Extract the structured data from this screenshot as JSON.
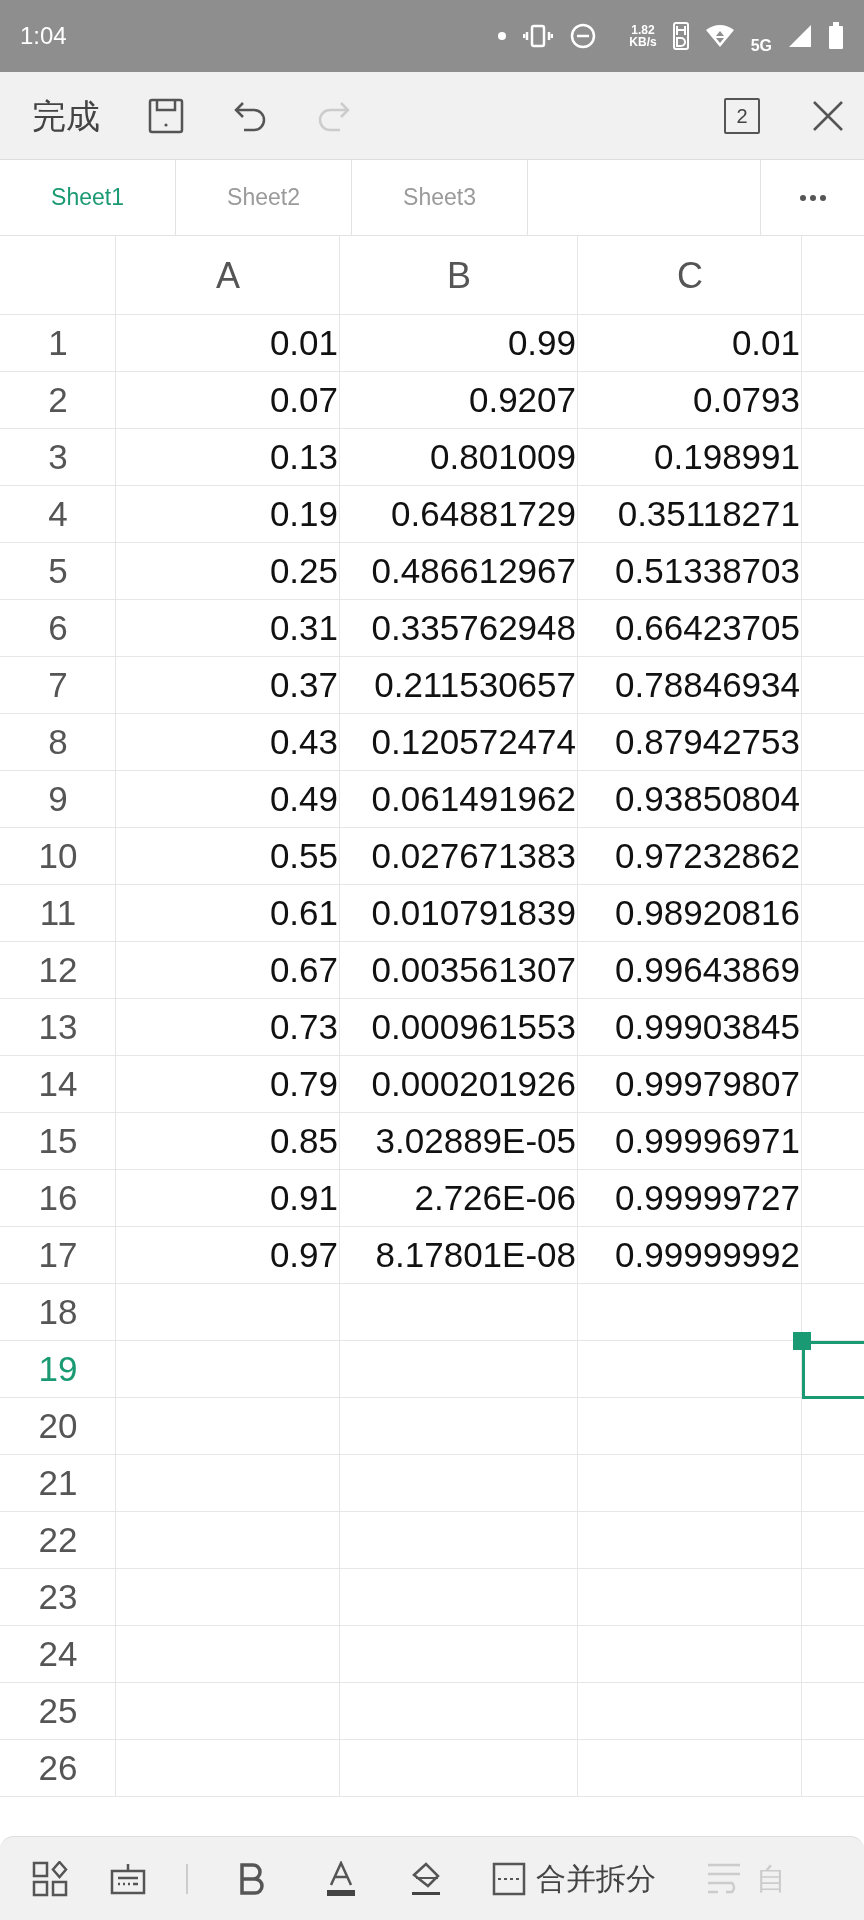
{
  "status_bar": {
    "time": "1:04",
    "speed_value": "1.82",
    "speed_unit": "KB/s",
    "network": "5G"
  },
  "toolbar": {
    "done": "完成",
    "undo_enabled": true,
    "redo_enabled": false,
    "window_count": "2"
  },
  "sheet_tabs": [
    {
      "label": "Sheet1",
      "selected": true
    },
    {
      "label": "Sheet2",
      "selected": false
    },
    {
      "label": "Sheet3",
      "selected": false
    }
  ],
  "table": {
    "columns": [
      "A",
      "B",
      "C"
    ],
    "rows": [
      {
        "number": "1",
        "selected": false,
        "cells": [
          "0.01",
          "0.99",
          "0.01"
        ]
      },
      {
        "number": "2",
        "selected": false,
        "cells": [
          "0.07",
          "0.9207",
          "0.0793"
        ]
      },
      {
        "number": "3",
        "selected": false,
        "cells": [
          "0.13",
          "0.801009",
          "0.198991"
        ]
      },
      {
        "number": "4",
        "selected": false,
        "cells": [
          "0.19",
          "0.64881729",
          "0.35118271"
        ]
      },
      {
        "number": "5",
        "selected": false,
        "cells": [
          "0.25",
          "0.486612967",
          "0.51338703"
        ]
      },
      {
        "number": "6",
        "selected": false,
        "cells": [
          "0.31",
          "0.335762948",
          "0.66423705"
        ]
      },
      {
        "number": "7",
        "selected": false,
        "cells": [
          "0.37",
          "0.211530657",
          "0.78846934"
        ]
      },
      {
        "number": "8",
        "selected": false,
        "cells": [
          "0.43",
          "0.120572474",
          "0.87942753"
        ]
      },
      {
        "number": "9",
        "selected": false,
        "cells": [
          "0.49",
          "0.061491962",
          "0.93850804"
        ]
      },
      {
        "number": "10",
        "selected": false,
        "cells": [
          "0.55",
          "0.027671383",
          "0.97232862"
        ]
      },
      {
        "number": "11",
        "selected": false,
        "cells": [
          "0.61",
          "0.010791839",
          "0.98920816"
        ]
      },
      {
        "number": "12",
        "selected": false,
        "cells": [
          "0.67",
          "0.003561307",
          "0.99643869"
        ]
      },
      {
        "number": "13",
        "selected": false,
        "cells": [
          "0.73",
          "0.000961553",
          "0.99903845"
        ]
      },
      {
        "number": "14",
        "selected": false,
        "cells": [
          "0.79",
          "0.000201926",
          "0.99979807"
        ]
      },
      {
        "number": "15",
        "selected": false,
        "cells": [
          "0.85",
          "3.02889E-05",
          "0.99996971"
        ]
      },
      {
        "number": "16",
        "selected": false,
        "cells": [
          "0.91",
          "2.726E-06",
          "0.99999727"
        ]
      },
      {
        "number": "17",
        "selected": false,
        "cells": [
          "0.97",
          "8.17801E-08",
          "0.99999992"
        ]
      },
      {
        "number": "18",
        "selected": false
      },
      {
        "number": "19",
        "selected": true
      },
      {
        "number": "20",
        "selected": false
      },
      {
        "number": "21",
        "selected": false
      },
      {
        "number": "22",
        "selected": false
      },
      {
        "number": "23",
        "selected": false
      },
      {
        "number": "24",
        "selected": false
      },
      {
        "number": "25",
        "selected": false
      },
      {
        "number": "26",
        "selected": false
      }
    ]
  },
  "bottom_toolbar": {
    "merge_label": "合并拆分",
    "wrap_label": "自"
  }
}
